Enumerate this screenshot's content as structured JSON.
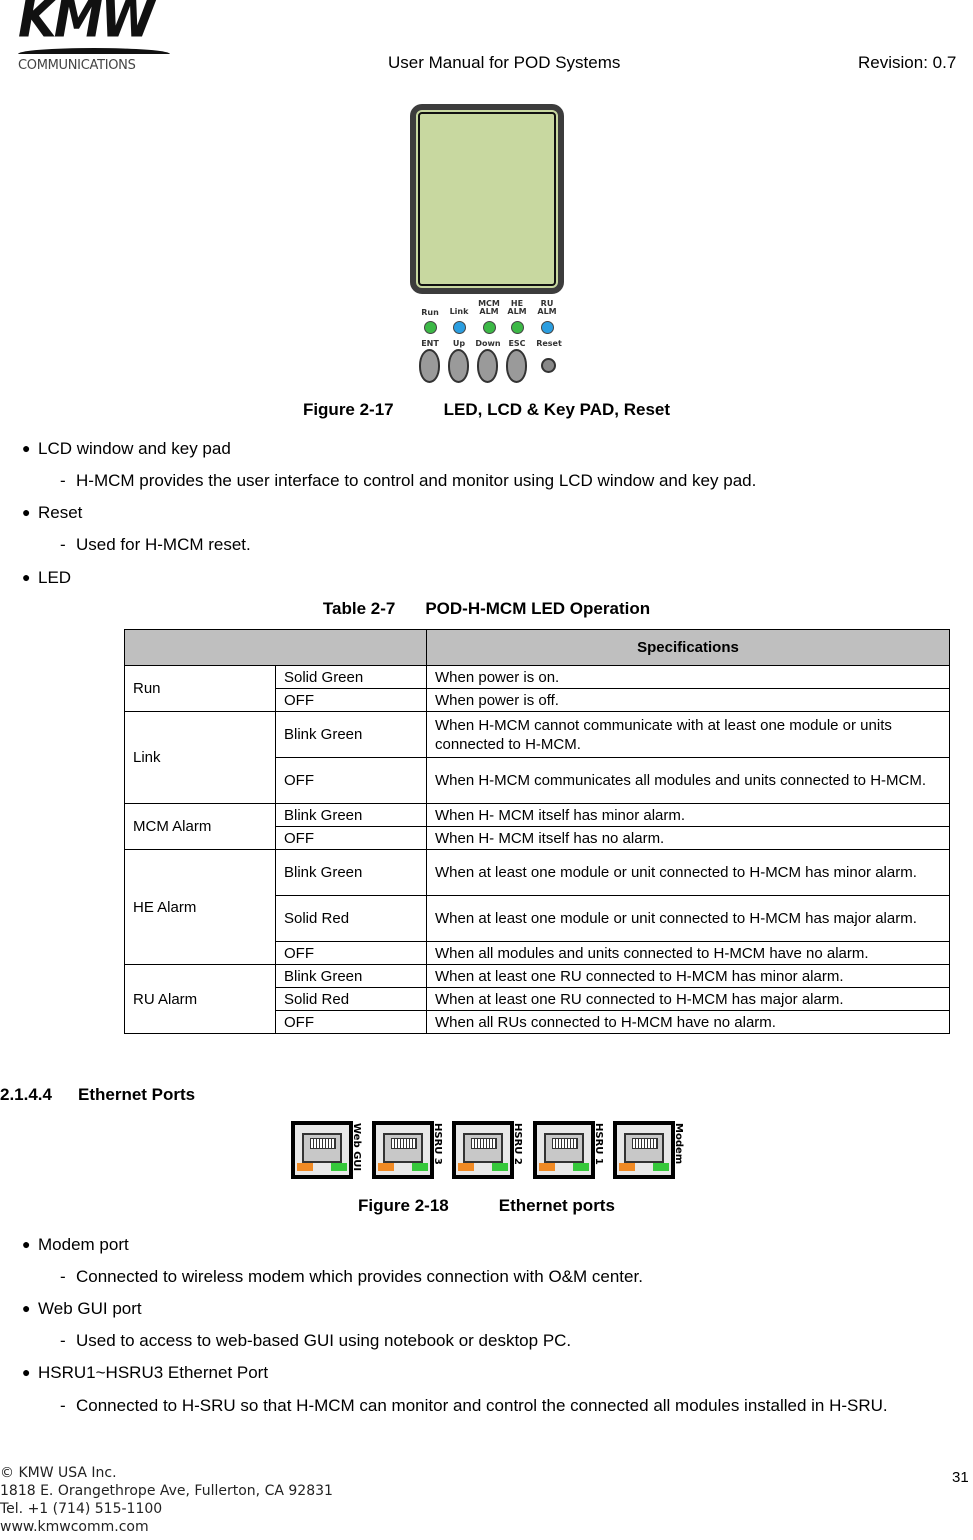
{
  "header": {
    "logo_word": "KMW",
    "logo_sub": "COMMUNICATIONS",
    "title": "User Manual for POD Systems",
    "revision": "Revision: 0.7"
  },
  "figure17": {
    "leds": [
      {
        "label": "Run",
        "color": "#3cb846"
      },
      {
        "label": "Link",
        "color": "#2b9ee0"
      },
      {
        "label": "MCM ALM",
        "color": "#3cb846"
      },
      {
        "label": "HE ALM",
        "color": "#3cb846"
      },
      {
        "label": "RU ALM",
        "color": "#2b9ee0"
      }
    ],
    "keys": [
      "ENT",
      "Up",
      "Down",
      "ESC"
    ],
    "reset_label": "Reset",
    "lcd_color": "#c8d8a0",
    "caption_num": "Figure 2-17",
    "caption_title": "LED, LCD & Key PAD, Reset"
  },
  "section1": {
    "items": [
      {
        "bullet": "LCD window and key pad",
        "detail": "H-MCM provides the user interface to control and monitor using LCD window and key pad."
      },
      {
        "bullet": "Reset",
        "detail": "Used for H-MCM reset."
      },
      {
        "bullet": "LED"
      }
    ]
  },
  "table": {
    "caption_num": "Table 2-7",
    "caption_title": "POD-H-MCM LED Operation",
    "header": "Specifications",
    "groups": [
      {
        "name": "Run",
        "rows": [
          {
            "state": "Solid Green",
            "desc": "When power is on."
          },
          {
            "state": "OFF",
            "desc": "When power is off."
          }
        ]
      },
      {
        "name": "Link",
        "rows": [
          {
            "state": "Blink Green",
            "desc": "When H-MCM cannot communicate with at least one module or units connected to H-MCM."
          },
          {
            "state": "OFF",
            "desc": "When H-MCM communicates all modules and units connected to H-MCM."
          }
        ]
      },
      {
        "name": "MCM Alarm",
        "rows": [
          {
            "state": "Blink Green",
            "desc": "When H- MCM itself has minor alarm."
          },
          {
            "state": "OFF",
            "desc": "When H- MCM itself has no alarm."
          }
        ]
      },
      {
        "name": "HE Alarm",
        "rows": [
          {
            "state": "Blink Green",
            "desc": "When at least one module or unit connected to H-MCM has minor alarm."
          },
          {
            "state": "Solid Red",
            "desc": "When at least one module or unit connected to H-MCM has major alarm."
          },
          {
            "state": "OFF",
            "desc": "When all modules and units connected to H-MCM have no alarm."
          }
        ]
      },
      {
        "name": "RU Alarm",
        "rows": [
          {
            "state": "Blink Green",
            "desc": "When at least one RU connected to H-MCM has minor alarm."
          },
          {
            "state": "Solid Red",
            "desc": "When at least one RU connected to H-MCM has major alarm."
          },
          {
            "state": "OFF",
            "desc": "When all RUs connected to H-MCM have no alarm."
          }
        ]
      }
    ]
  },
  "section2": {
    "heading_num": "2.1.4.4",
    "heading_title": "Ethernet Ports",
    "ports": [
      "Web GUI",
      "HSRU 3",
      "HSRU 2",
      "HSRU 1",
      "Modem"
    ],
    "caption_num": "Figure 2-18",
    "caption_title": "Ethernet ports",
    "items": [
      {
        "bullet": "Modem port",
        "detail": "Connected to wireless modem which provides connection with O&M center."
      },
      {
        "bullet": "Web GUI port",
        "detail": "Used to access to web-based GUI using notebook or desktop PC."
      },
      {
        "bullet": "HSRU1~HSRU3 Ethernet Port",
        "detail": "Connected to H-SRU so that H-MCM can monitor and control the connected all modules installed in H-SRU."
      }
    ]
  },
  "footer": {
    "lines": [
      "© KMW USA Inc.",
      "1818 E. Orangethrope Ave, Fullerton, CA 92831",
      "Tel. +1 (714) 515-1100",
      "www.kmwcomm.com"
    ],
    "page_number": "31"
  }
}
